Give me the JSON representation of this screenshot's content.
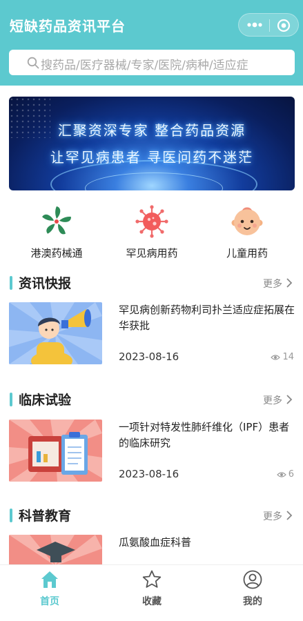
{
  "app": {
    "title": "短缺药品资讯平台"
  },
  "search": {
    "placeholder": "搜药品/医疗器械/专家/医院/病种/适应症"
  },
  "banner": {
    "line1": "汇聚资深专家  整合药品资源",
    "line2": "让罕见病患者  寻医问药不迷茫"
  },
  "quick_links": [
    {
      "label": "港澳药械通",
      "icon": "bauhinia-flower-icon"
    },
    {
      "label": "罕见病用药",
      "icon": "virus-icon"
    },
    {
      "label": "儿童用药",
      "icon": "baby-face-icon"
    }
  ],
  "sections": [
    {
      "title": "资讯快报",
      "more": "更多",
      "articles": [
        {
          "title": "罕见病创新药物利司扑兰适应症拓展在华获批",
          "date": "2023-08-16",
          "views": "14"
        }
      ]
    },
    {
      "title": "临床试验",
      "more": "更多",
      "articles": [
        {
          "title": "一项针对特发性肺纤维化（IPF）患者的临床研究",
          "date": "2023-08-16",
          "views": "6"
        }
      ]
    },
    {
      "title": "科普教育",
      "more": "更多",
      "articles": [
        {
          "title": "瓜氨酸血症科普"
        }
      ]
    }
  ],
  "tabbar": {
    "items": [
      {
        "label": "首页",
        "icon": "home-icon",
        "active": true
      },
      {
        "label": "收藏",
        "icon": "star-icon",
        "active": false
      },
      {
        "label": "我的",
        "icon": "user-icon",
        "active": false
      }
    ]
  },
  "colors": {
    "primary": "#5cc9cf",
    "text": "#222222",
    "muted": "#999999"
  }
}
